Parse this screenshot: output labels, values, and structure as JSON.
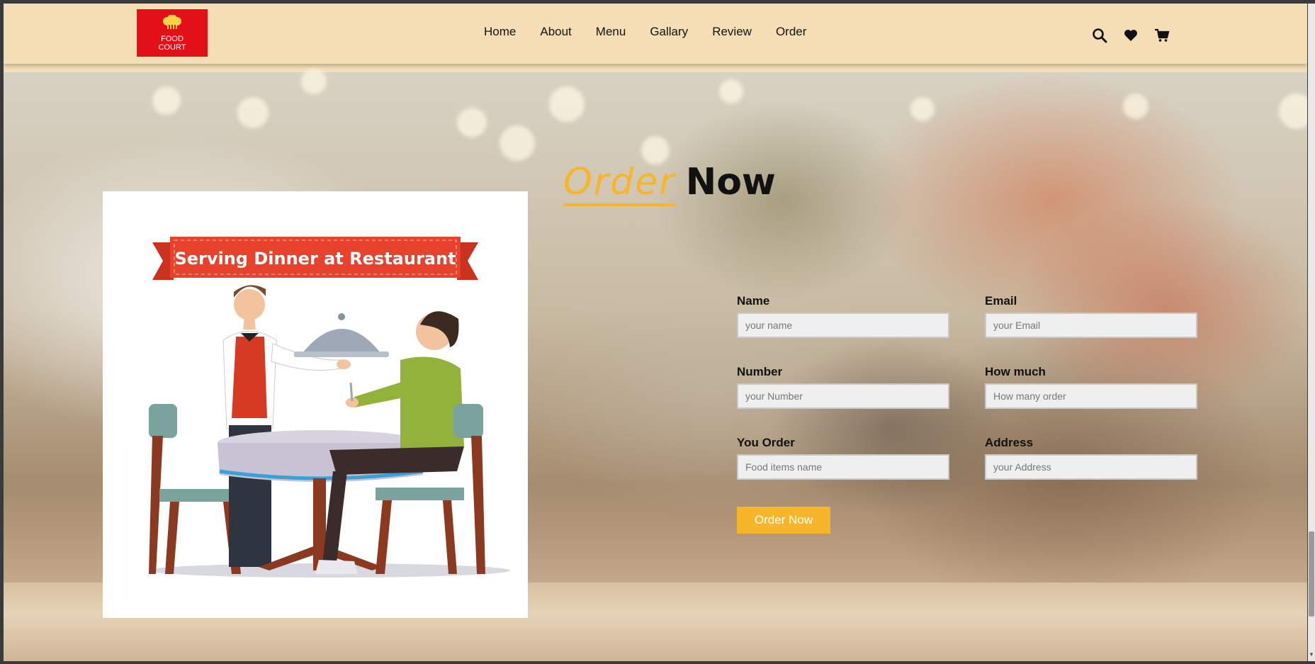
{
  "logo": {
    "text": "FOOD\nCOURT"
  },
  "nav": [
    "Home",
    "About",
    "Menu",
    "Gallary",
    "Review",
    "Order"
  ],
  "header_icons": [
    "search-icon",
    "heart-icon",
    "cart-icon"
  ],
  "section": {
    "title_accent": "Order",
    "title_rest": "Now"
  },
  "illustration": {
    "banner_text": "Serving Dinner at Restaurant"
  },
  "form": {
    "fields": [
      {
        "label": "Name",
        "placeholder": "your name"
      },
      {
        "label": "Email",
        "placeholder": "your Email"
      },
      {
        "label": "Number",
        "placeholder": "your Number"
      },
      {
        "label": "How much",
        "placeholder": "How many order"
      },
      {
        "label": "You Order",
        "placeholder": "Food items name"
      },
      {
        "label": "Address",
        "placeholder": "your Address"
      }
    ],
    "submit_label": "Order Now"
  },
  "colors": {
    "header_bg": "#f5deb6",
    "accent": "#f7b52a",
    "logo_bg": "#e3101a",
    "banner_red": "#e8412c"
  }
}
